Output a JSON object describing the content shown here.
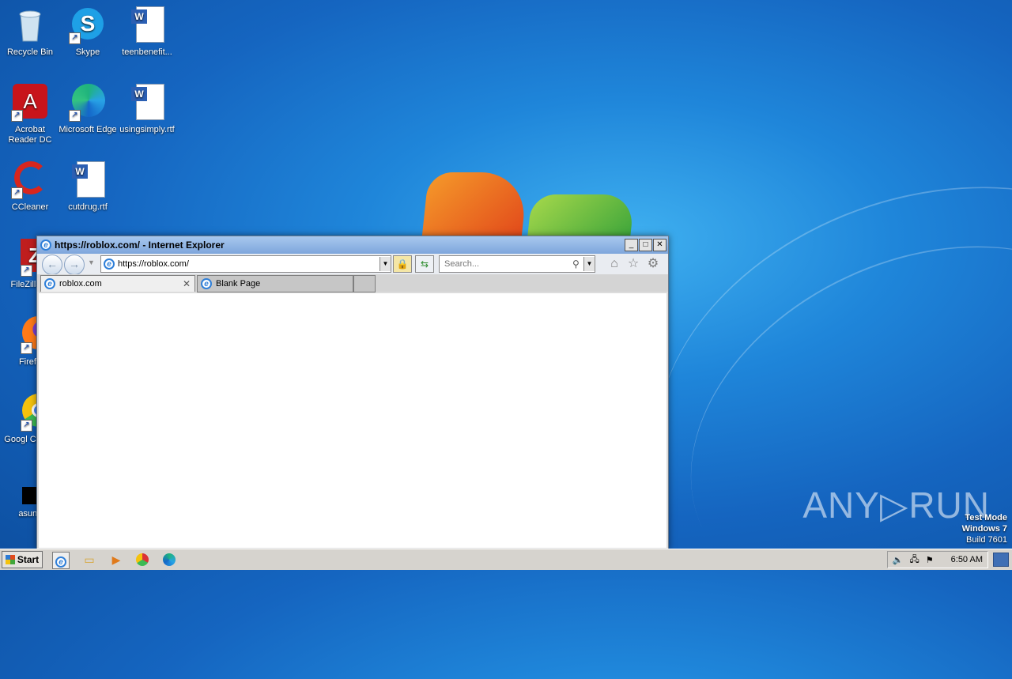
{
  "desktop": {
    "icons": [
      {
        "label": "Recycle Bin"
      },
      {
        "label": "Skype"
      },
      {
        "label": "teenbenefit..."
      },
      {
        "label": "Acrobat Reader DC"
      },
      {
        "label": "Microsoft Edge"
      },
      {
        "label": "usingsimply.rtf"
      },
      {
        "label": "CCleaner"
      },
      {
        "label": "cutdrug.rtf"
      },
      {
        "label": "FileZilla C"
      },
      {
        "label": "Firefo"
      },
      {
        "label": "Googl Chrom"
      },
      {
        "label": "asun.j"
      }
    ]
  },
  "ie": {
    "title": "https://roblox.com/ - Internet Explorer",
    "address": "https://roblox.com/",
    "search_placeholder": "Search...",
    "tabs": [
      {
        "label": "roblox.com"
      },
      {
        "label": "Blank Page"
      }
    ]
  },
  "taskbar": {
    "start_label": "Start",
    "clock": "6:50 AM"
  },
  "watermark": {
    "brand": "ANY▷RUN",
    "line1": "Test Mode",
    "line2": "Windows 7",
    "line3": "Build 7601"
  }
}
